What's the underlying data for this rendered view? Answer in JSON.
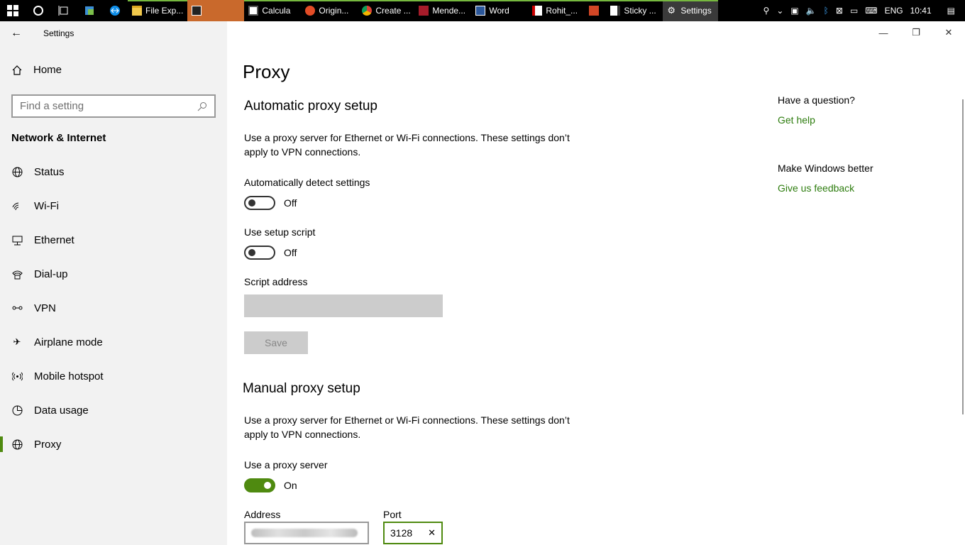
{
  "taskbar": {
    "apps": [
      {
        "label": "File Exp...",
        "icon": "folder-icon"
      },
      {
        "label": "",
        "icon": "terminal-icon"
      },
      {
        "label": "Calcula",
        "icon": "calculator-icon"
      },
      {
        "label": "Origin...",
        "icon": "origin-icon"
      },
      {
        "label": "Create ...",
        "icon": "chrome-icon"
      },
      {
        "label": "Mende...",
        "icon": "mendeley-icon"
      },
      {
        "label": "Word",
        "icon": "word-icon"
      },
      {
        "label": "Rohit_...",
        "icon": "pdf-icon"
      },
      {
        "label": "",
        "icon": "powerpoint-icon"
      },
      {
        "label": "Sticky ...",
        "icon": "sticky-notes-icon"
      },
      {
        "label": "Settings",
        "icon": "gear-icon"
      }
    ],
    "tray": {
      "language": "ENG",
      "time": "10:41"
    }
  },
  "sidebar": {
    "window_title": "Settings",
    "home": "Home",
    "search_placeholder": "Find a setting",
    "group_title": "Network & Internet",
    "items": [
      {
        "label": "Status",
        "icon": "globe-icon"
      },
      {
        "label": "Wi-Fi",
        "icon": "wifi-icon"
      },
      {
        "label": "Ethernet",
        "icon": "ethernet-icon"
      },
      {
        "label": "Dial-up",
        "icon": "dialup-icon"
      },
      {
        "label": "VPN",
        "icon": "vpn-icon"
      },
      {
        "label": "Airplane mode",
        "icon": "airplane-icon"
      },
      {
        "label": "Mobile hotspot",
        "icon": "hotspot-icon"
      },
      {
        "label": "Data usage",
        "icon": "data-usage-icon"
      },
      {
        "label": "Proxy",
        "icon": "globe-icon",
        "selected": true
      }
    ]
  },
  "main": {
    "title": "Proxy",
    "auto": {
      "title": "Automatic proxy setup",
      "desc": "Use a proxy server for Ethernet or Wi-Fi connections. These settings don’t apply to VPN connections.",
      "detect_label": "Automatically detect settings",
      "detect_state": "Off",
      "script_label": "Use setup script",
      "script_state": "Off",
      "address_label": "Script address",
      "save_label": "Save"
    },
    "manual": {
      "title": "Manual proxy setup",
      "desc": "Use a proxy server for Ethernet or Wi-Fi connections. These settings don’t apply to VPN connections.",
      "use_label": "Use a proxy server",
      "use_state": "On",
      "address_label": "Address",
      "port_label": "Port",
      "port_value": "3128"
    }
  },
  "right": {
    "question": "Have a question?",
    "get_help": "Get help",
    "better": "Make Windows better",
    "feedback": "Give us feedback"
  },
  "colors": {
    "accent": "#4f8a10",
    "link": "#2e7d0f",
    "sidebar_bg": "#f2f2f2"
  }
}
